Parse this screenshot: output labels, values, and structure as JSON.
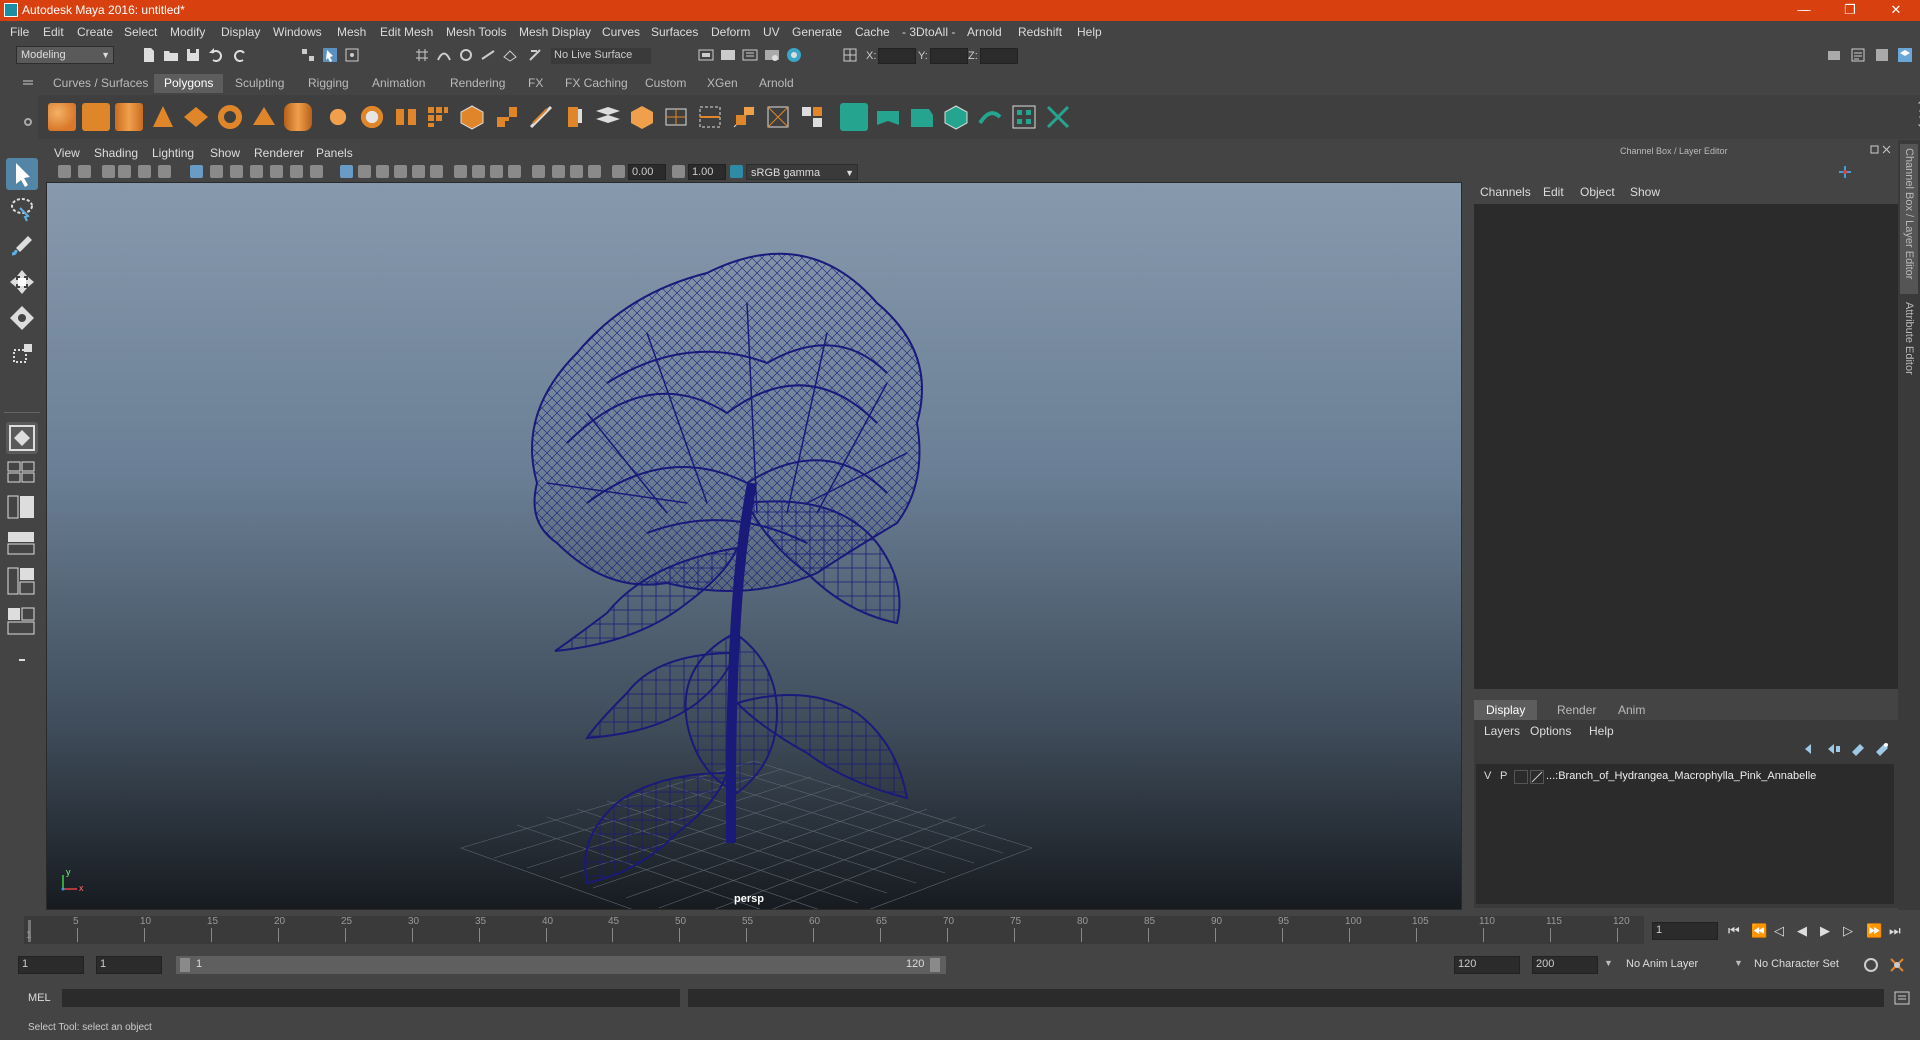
{
  "window": {
    "title": "Autodesk Maya 2016: untitled*",
    "minimize": "—",
    "maximize": "❐",
    "close": "✕"
  },
  "menus": [
    "File",
    "Edit",
    "Create",
    "Select",
    "Modify",
    "Display",
    "Windows",
    "Mesh",
    "Edit Mesh",
    "Mesh Tools",
    "Mesh Display",
    "Curves",
    "Surfaces",
    "Deform",
    "UV",
    "Generate",
    "Cache",
    "- 3DtoAll -",
    "Arnold",
    "Redshift",
    "Help"
  ],
  "status": {
    "mode": "Modeling",
    "live_surface": "No Live Surface",
    "x_label": "X:",
    "y_label": "Y:",
    "z_label": "Z:"
  },
  "shelf_tabs": [
    "Curves / Surfaces",
    "Polygons",
    "Sculpting",
    "Rigging",
    "Animation",
    "Rendering",
    "FX",
    "FX Caching",
    "Custom",
    "XGen",
    "Arnold"
  ],
  "shelf_active": "Polygons",
  "viewport": {
    "menus": [
      "View",
      "Shading",
      "Lighting",
      "Show",
      "Renderer",
      "Panels"
    ],
    "exposure": "0.00",
    "gamma": "1.00",
    "color_space": "sRGB gamma",
    "camera_label": "persp",
    "axis_x": "x",
    "axis_y": "y",
    "wire_color": "#1a1a7a"
  },
  "channel_box": {
    "title": "Channel Box / Layer Editor",
    "menus": [
      "Channels",
      "Edit",
      "Object",
      "Show"
    ],
    "side_tab_1": "Channel Box / Layer Editor",
    "side_tab_2": "Attribute Editor"
  },
  "layer_editor": {
    "tabs": [
      "Display",
      "Render",
      "Anim"
    ],
    "active_tab": "Display",
    "menus": [
      "Layers",
      "Options",
      "Help"
    ],
    "layer": {
      "v": "V",
      "p": "P",
      "name": "...:Branch_of_Hydrangea_Macrophylla_Pink_Annabelle"
    }
  },
  "timeline": {
    "ticks": [
      "5",
      "10",
      "15",
      "20",
      "25",
      "30",
      "35",
      "40",
      "45",
      "50",
      "55",
      "60",
      "65",
      "70",
      "75",
      "80",
      "85",
      "90",
      "95",
      "100",
      "105",
      "110",
      "115",
      "120"
    ],
    "start_tick": "1",
    "current_frame": "1"
  },
  "range": {
    "start": "1",
    "playback_start": "1",
    "slider_start": "1",
    "slider_end": "120",
    "playback_end": "120",
    "end": "200",
    "anim_layer": "No Anim Layer",
    "character_set": "No Character Set"
  },
  "command_line": {
    "label": "MEL"
  },
  "help_line": "Select Tool: select an object",
  "colors": {
    "title_bar": "#d9400f",
    "accent": "#1b8fa0",
    "shelf_orange": "#e0862a",
    "shelf_teal": "#25a58f"
  }
}
